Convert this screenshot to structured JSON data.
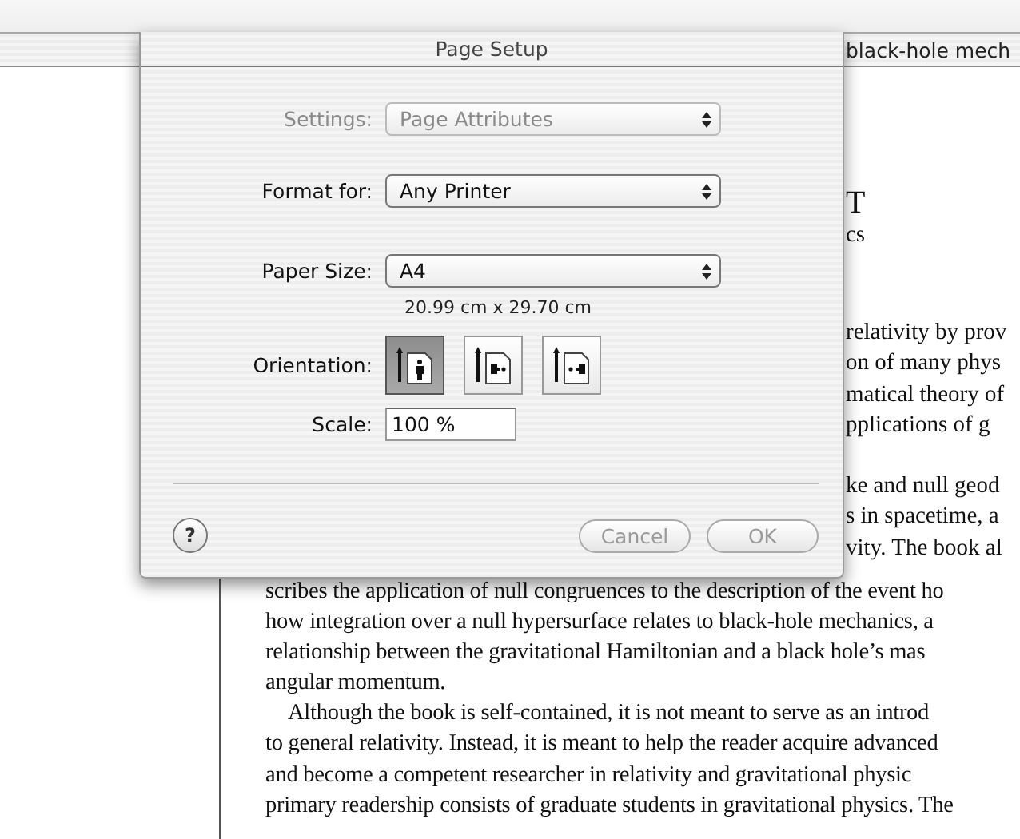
{
  "background_window": {
    "title": "black-hole mech",
    "fragment_groups": [
      [
        {
          "text": "T",
          "kind": "heading"
        },
        {
          "text": "cs",
          "kind": "body"
        }
      ],
      [
        {
          "text": "relativity by prov",
          "kind": "body"
        },
        {
          "text": "on of many phys",
          "kind": "body"
        },
        {
          "text": "matical theory of",
          "kind": "body"
        },
        {
          "text": "pplications of g",
          "kind": "body"
        }
      ],
      [
        {
          "text": "ke and null geod",
          "kind": "body"
        },
        {
          "text": "s in spacetime, a",
          "kind": "body"
        },
        {
          "text": "vity. The book al",
          "kind": "body"
        }
      ]
    ],
    "lines": [
      {
        "text": "scribes the application of null congruences to the description of the event ho",
        "indent": false
      },
      {
        "text": "how integration over a null hypersurface relates to black-hole mechanics, a",
        "indent": false
      },
      {
        "text": "relationship between the gravitational Hamiltonian and a black hole’s mas",
        "indent": false
      },
      {
        "text": "angular momentum.",
        "indent": false
      },
      {
        "text": "Although the book is self-contained, it is not meant to serve as an introd",
        "indent": true
      },
      {
        "text": "to general relativity. Instead, it is meant to help the reader acquire advanced",
        "indent": false
      },
      {
        "text": "and become a competent researcher in relativity and gravitational physic",
        "indent": false
      },
      {
        "text": "primary readership consists of graduate students in gravitational physics. The",
        "indent": false
      }
    ]
  },
  "dialog": {
    "title": "Page Setup",
    "rows": [
      {
        "kind": "popup",
        "label": "Settings:",
        "value": "Page Attributes",
        "disabled": true
      },
      {
        "kind": "popup",
        "label": "Format for:",
        "value": "Any Printer",
        "disabled": false
      },
      {
        "kind": "popup",
        "label": "Paper Size:",
        "value": "A4",
        "disabled": false,
        "note": "20.99 cm x 29.70 cm"
      },
      {
        "kind": "orientation",
        "label": "Orientation:",
        "options": [
          {
            "kind": "portrait",
            "selected": true
          },
          {
            "kind": "landscape",
            "selected": false
          },
          {
            "kind": "reverse-landscape",
            "selected": false
          }
        ]
      },
      {
        "kind": "field",
        "label": "Scale:",
        "value": "100 %"
      }
    ],
    "help": "?",
    "buttons": [
      {
        "label": "Cancel"
      },
      {
        "label": "OK"
      }
    ]
  }
}
